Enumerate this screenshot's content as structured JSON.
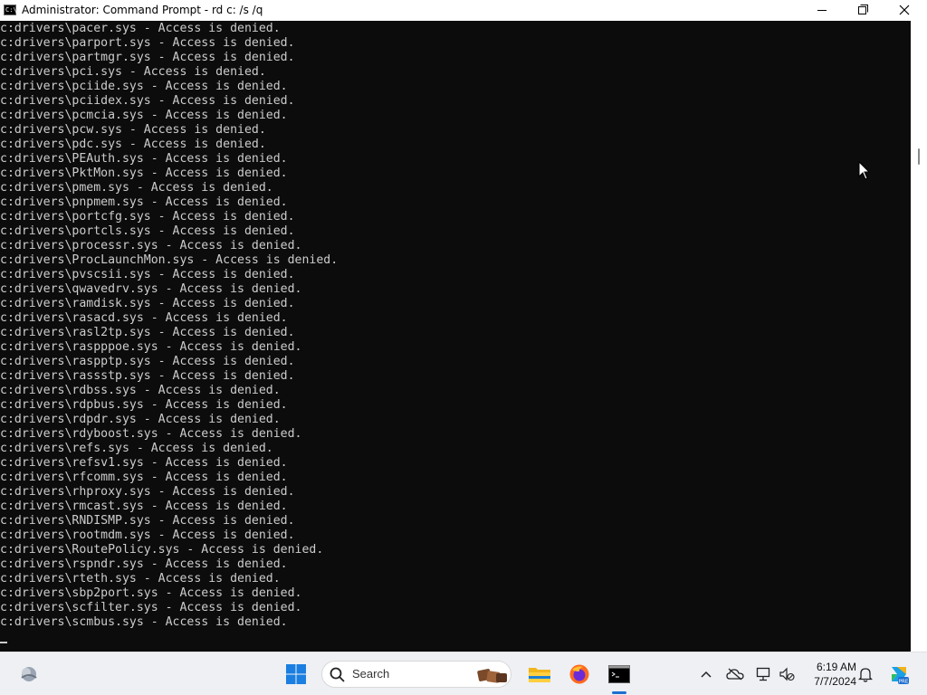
{
  "window": {
    "title": "Administrator: Command Prompt - rd  c: /s /q",
    "icon_label": "C:\\"
  },
  "console": {
    "text_color": "#cccccc",
    "background": "#0c0c0c",
    "lines": [
      "c:drivers\\pacer.sys - Access is denied.",
      "c:drivers\\parport.sys - Access is denied.",
      "c:drivers\\partmgr.sys - Access is denied.",
      "c:drivers\\pci.sys - Access is denied.",
      "c:drivers\\pciide.sys - Access is denied.",
      "c:drivers\\pciidex.sys - Access is denied.",
      "c:drivers\\pcmcia.sys - Access is denied.",
      "c:drivers\\pcw.sys - Access is denied.",
      "c:drivers\\pdc.sys - Access is denied.",
      "c:drivers\\PEAuth.sys - Access is denied.",
      "c:drivers\\PktMon.sys - Access is denied.",
      "c:drivers\\pmem.sys - Access is denied.",
      "c:drivers\\pnpmem.sys - Access is denied.",
      "c:drivers\\portcfg.sys - Access is denied.",
      "c:drivers\\portcls.sys - Access is denied.",
      "c:drivers\\processr.sys - Access is denied.",
      "c:drivers\\ProcLaunchMon.sys - Access is denied.",
      "c:drivers\\pvscsii.sys - Access is denied.",
      "c:drivers\\qwavedrv.sys - Access is denied.",
      "c:drivers\\ramdisk.sys - Access is denied.",
      "c:drivers\\rasacd.sys - Access is denied.",
      "c:drivers\\rasl2tp.sys - Access is denied.",
      "c:drivers\\raspppoe.sys - Access is denied.",
      "c:drivers\\raspptp.sys - Access is denied.",
      "c:drivers\\rassstp.sys - Access is denied.",
      "c:drivers\\rdbss.sys - Access is denied.",
      "c:drivers\\rdpbus.sys - Access is denied.",
      "c:drivers\\rdpdr.sys - Access is denied.",
      "c:drivers\\rdyboost.sys - Access is denied.",
      "c:drivers\\refs.sys - Access is denied.",
      "c:drivers\\refsv1.sys - Access is denied.",
      "c:drivers\\rfcomm.sys - Access is denied.",
      "c:drivers\\rhproxy.sys - Access is denied.",
      "c:drivers\\rmcast.sys - Access is denied.",
      "c:drivers\\RNDISMP.sys - Access is denied.",
      "c:drivers\\rootmdm.sys - Access is denied.",
      "c:drivers\\RoutePolicy.sys - Access is denied.",
      "c:drivers\\rspndr.sys - Access is denied.",
      "c:drivers\\rteth.sys - Access is denied.",
      "c:drivers\\sbp2port.sys - Access is denied.",
      "c:drivers\\scfilter.sys - Access is denied.",
      "c:drivers\\scmbus.sys - Access is denied."
    ]
  },
  "taskbar": {
    "search_placeholder": "Search",
    "time": "6:19 AM",
    "date": "7/7/2024",
    "icons": {
      "widgets": "weather-widget-icon",
      "start": "windows-start-icon",
      "search": "search-icon",
      "search_highlight": "search-highlight-icon",
      "file_explorer": "file-explorer-icon",
      "firefox": "firefox-icon",
      "terminal": "command-prompt-icon",
      "tray_overflow": "chevron-up-icon",
      "onedrive": "onedrive-icon",
      "network": "network-icon",
      "volume": "volume-muted-icon",
      "notifications": "bell-icon",
      "copilot": "copilot-icon"
    },
    "accent_color": "#1e6fd0"
  }
}
